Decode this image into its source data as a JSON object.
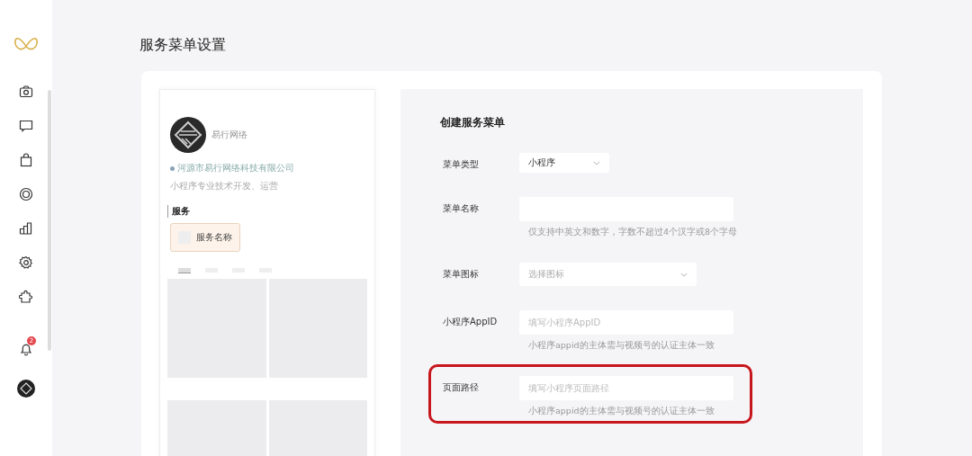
{
  "sidebar": {
    "notification_badge": "2"
  },
  "page_title": "服务菜单设置",
  "preview": {
    "account_name": "易行网络",
    "company": "河源市易行网络科技有限公司",
    "intro": "小程序专业技术开发、运营",
    "section_title": "服务",
    "service_button": "服务名称"
  },
  "form": {
    "title": "创建服务菜单",
    "rows": [
      {
        "kind": "select",
        "label": "菜单类型",
        "value": "小程序",
        "highlighted": false
      },
      {
        "kind": "input",
        "label": "菜单名称",
        "hint": "仅支持中英文和数字，字数不超过4个汉字或8个字母",
        "highlighted": false
      },
      {
        "kind": "select-wide",
        "label": "菜单图标",
        "placeholder": "选择图标",
        "highlighted": false
      },
      {
        "kind": "input",
        "label": "小程序AppID",
        "placeholder": "填写小程序AppID",
        "hint": "小程序appid的主体需与视频号的认证主体一致",
        "highlighted": false
      },
      {
        "kind": "input",
        "label": "页面路径",
        "placeholder": "填写小程序页面路径",
        "hint": "小程序appid的主体需与视频号的认证主体一致",
        "highlighted": true
      }
    ]
  }
}
